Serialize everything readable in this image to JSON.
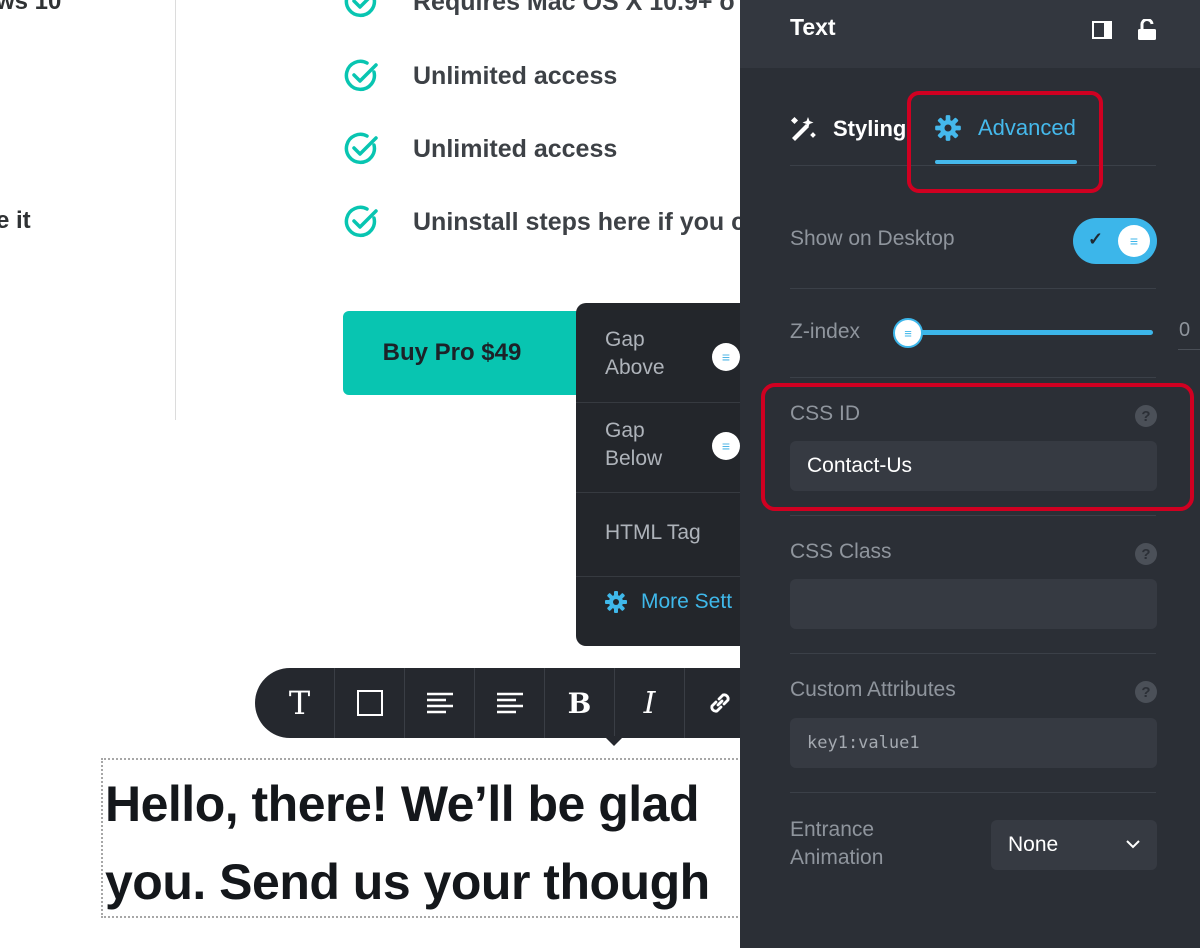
{
  "page": {
    "left_fragments": [
      "ws 10",
      "e it"
    ],
    "features": [
      "Requires Mac OS X 10.9+ o",
      "Unlimited access",
      "Unlimited access",
      "Uninstall steps here if you c"
    ],
    "buy_button": "Buy Pro $49",
    "headline_lines": [
      "Hello, there! We’ll be glad",
      "you. Send us your though"
    ]
  },
  "gap_popup": {
    "gap_above": "Gap\nAbove",
    "gap_below": "Gap\nBelow",
    "html_tag": "HTML Tag",
    "more_settings": "More Sett"
  },
  "toolbar": {
    "buttons": [
      "text-type",
      "box",
      "align-left",
      "align-center",
      "bold",
      "italic",
      "link"
    ],
    "labels": {
      "text": "T",
      "bold": "B",
      "italic": "I"
    }
  },
  "panel": {
    "title": "Text",
    "tabs": [
      {
        "label": "Styling",
        "active": false
      },
      {
        "label": "Advanced",
        "active": true
      }
    ],
    "show_on_desktop": {
      "label": "Show on Desktop",
      "on": true
    },
    "z_index": {
      "label": "Z-index",
      "value": "0"
    },
    "css_id": {
      "label": "CSS ID",
      "value": "Contact-Us"
    },
    "css_class": {
      "label": "CSS Class",
      "value": ""
    },
    "custom_attributes": {
      "label": "Custom Attributes",
      "placeholder": "key1:value1"
    },
    "entrance_animation": {
      "label": "Entrance\nAnimation",
      "value": "None"
    },
    "help_glyph": "?"
  },
  "colors": {
    "accent": "#3cb6ea",
    "teal": "#08c5b1",
    "highlight": "#d00021",
    "panel_bg": "#2b2f36"
  }
}
